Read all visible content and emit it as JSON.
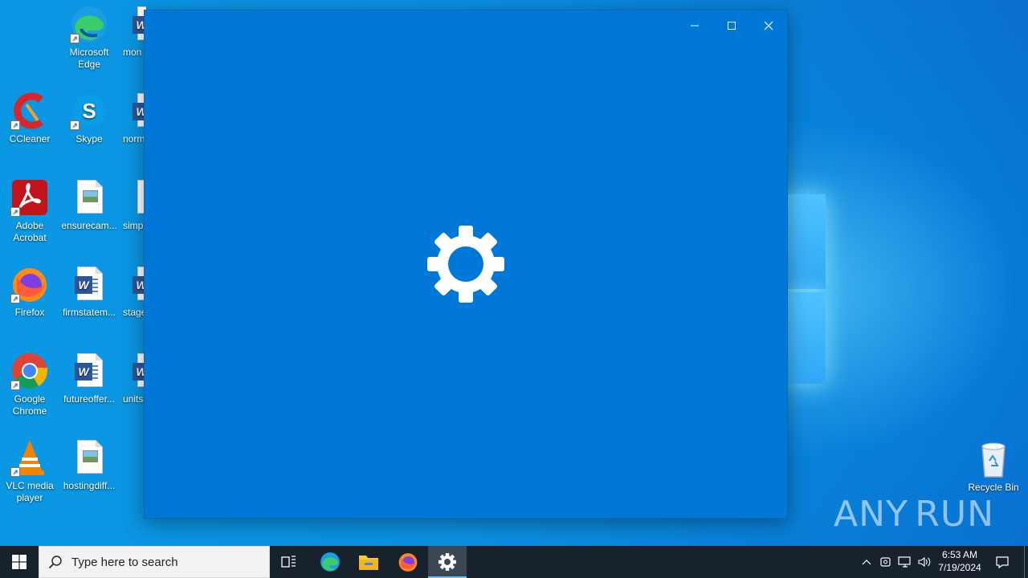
{
  "desktop": {
    "icons": [
      {
        "label": "Microsoft Edge",
        "icon": "edge-icon"
      },
      {
        "label": "mon",
        "icon": "word-doc-icon"
      },
      {
        "label": "CCleaner",
        "icon": "ccleaner-icon"
      },
      {
        "label": "Skype",
        "icon": "skype-icon"
      },
      {
        "label": "norm",
        "icon": "word-doc-icon"
      },
      {
        "label": "Adobe Acrobat",
        "icon": "acrobat-icon"
      },
      {
        "label": "ensurecam...",
        "icon": "image-file-icon"
      },
      {
        "label": "simp",
        "icon": "image-file-icon"
      },
      {
        "label": "Firefox",
        "icon": "firefox-icon"
      },
      {
        "label": "firmstatem...",
        "icon": "word-doc-icon"
      },
      {
        "label": "stage",
        "icon": "word-doc-icon"
      },
      {
        "label": "Google Chrome",
        "icon": "chrome-icon"
      },
      {
        "label": "futureoffer...",
        "icon": "word-doc-icon"
      },
      {
        "label": "units",
        "icon": "word-doc-icon"
      },
      {
        "label": "VLC media player",
        "icon": "vlc-icon"
      },
      {
        "label": "hostingdiff...",
        "icon": "image-file-icon"
      }
    ],
    "recycle_bin": {
      "label": "Recycle Bin",
      "icon": "recycle-bin-icon"
    },
    "watermark": {
      "left": "ANY",
      "right": "RUN"
    }
  },
  "settings_window": {
    "icon": "gear-icon",
    "buttons": {
      "minimize": "minimize-icon",
      "maximize": "maximize-icon",
      "close": "close-icon"
    }
  },
  "taskbar": {
    "search_placeholder": "Type here to search",
    "apps": [
      "task-view-icon",
      "edge-icon",
      "file-explorer-icon",
      "firefox-icon",
      "settings-icon"
    ],
    "active_app": "settings",
    "clock": {
      "time": "6:53 AM",
      "date": "7/19/2024"
    },
    "colors": {
      "taskbar": "#17222c",
      "window": "#0078d7",
      "accent": "#76b9ed"
    }
  }
}
